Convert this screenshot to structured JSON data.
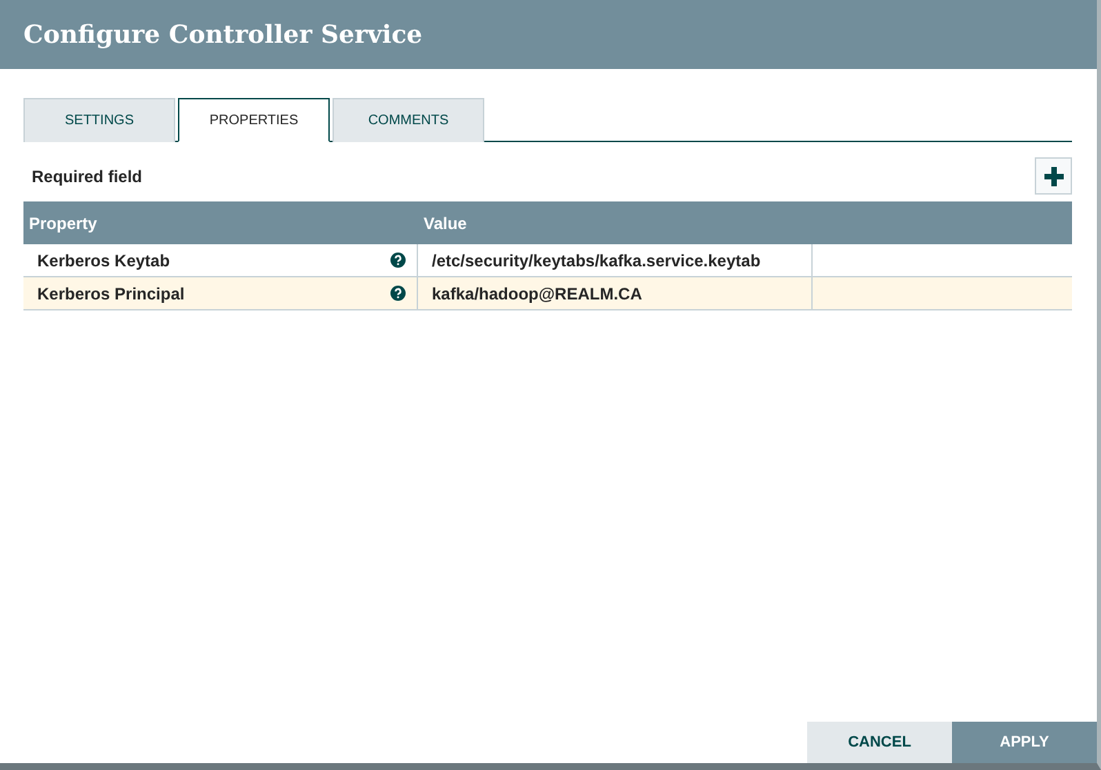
{
  "window": {
    "title": "Configure Controller Service"
  },
  "tabs": [
    {
      "label": "SETTINGS",
      "selected": false
    },
    {
      "label": "PROPERTIES",
      "selected": true
    },
    {
      "label": "COMMENTS",
      "selected": false
    }
  ],
  "required_label": "Required field",
  "table": {
    "columns": [
      "Property",
      "Value"
    ],
    "rows": [
      {
        "property": "Kerberos Keytab",
        "value": "/etc/security/keytabs/kafka.service.keytab",
        "selected": false
      },
      {
        "property": "Kerberos Principal",
        "value": "kafka/hadoop@REALM.CA",
        "selected": true
      }
    ]
  },
  "buttons": [
    {
      "label": "CANCEL",
      "kind": "secondary"
    },
    {
      "label": "APPLY",
      "kind": "primary"
    }
  ]
}
